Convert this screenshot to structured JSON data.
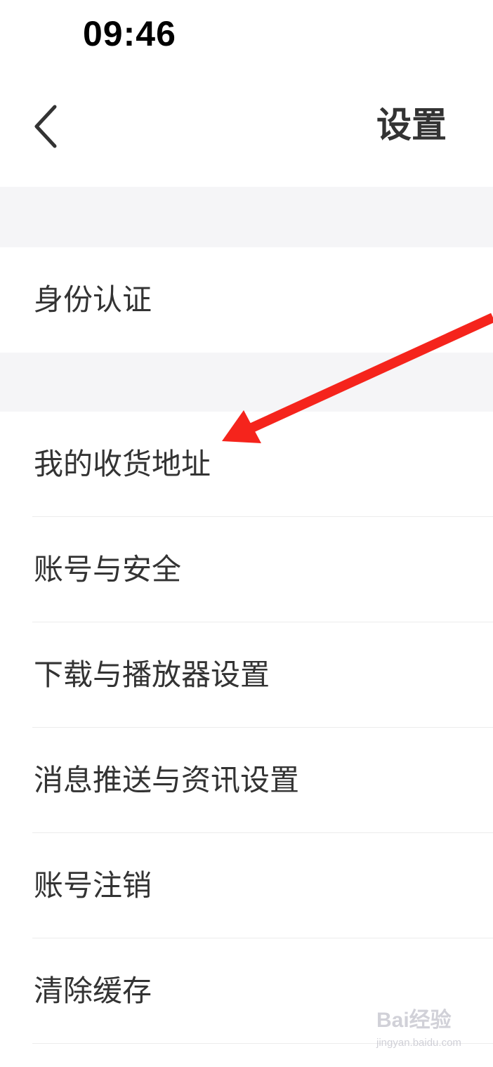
{
  "status_bar": {
    "time": "09:46"
  },
  "nav": {
    "title": "设置",
    "back_icon": "chevron-left-icon"
  },
  "settings": {
    "identity": {
      "label": "身份认证"
    },
    "items": [
      {
        "label": "我的收货地址"
      },
      {
        "label": "账号与安全"
      },
      {
        "label": "下载与播放器设置"
      },
      {
        "label": "消息推送与资讯设置"
      },
      {
        "label": "账号注销"
      },
      {
        "label": "清除缓存"
      }
    ]
  },
  "annotation": {
    "type": "red-arrow-pointer",
    "color": "#f5241c"
  },
  "watermark": {
    "brand": "Bai经验",
    "url": "jingyan.baidu.com"
  },
  "colors": {
    "background": "#ffffff",
    "section_gap": "#f5f5f7",
    "text": "#333333",
    "divider": "#ececec"
  }
}
